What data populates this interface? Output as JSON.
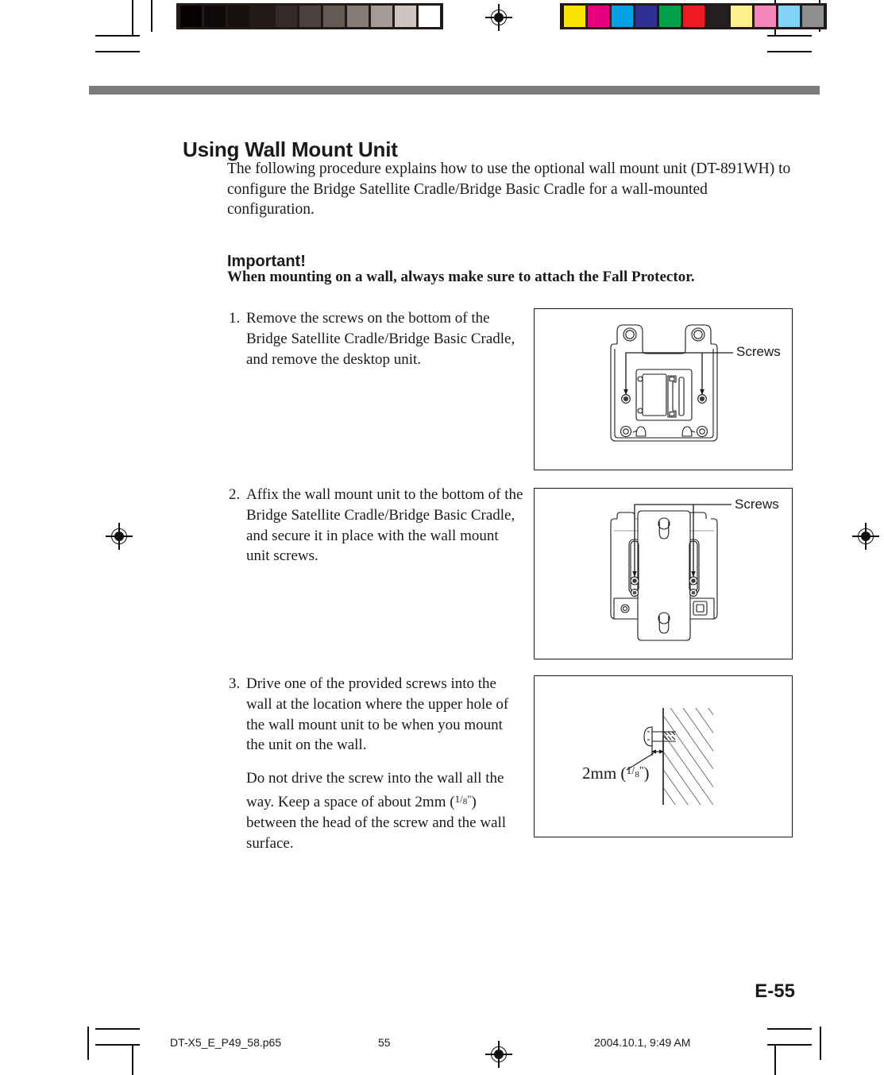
{
  "document": {
    "heading": "Using Wall Mount Unit",
    "intro": "The following procedure explains how to use the optional wall mount unit (DT-891WH) to configure the Bridge Satellite Cradle/Bridge Basic Cradle for a wall-mounted configuration.",
    "important_heading": "Important!",
    "important_text": "When mounting on a wall, always make sure to attach the Fall Protector.",
    "page_number": "E-55"
  },
  "steps": [
    {
      "number": "1.",
      "paragraphs": [
        "Remove the screws on the bottom of the Bridge Satellite Cradle/Bridge Basic Cradle, and remove the desktop unit."
      ]
    },
    {
      "number": "2.",
      "paragraphs": [
        "Affix the wall mount unit to the bottom of the Bridge Satellite Cradle/Bridge Basic Cradle, and secure it in place with the wall mount unit screws."
      ]
    },
    {
      "number": "3.",
      "paragraphs": [
        "Drive one of the provided screws into the wall at the location where the upper hole of the wall mount unit to be when you mount the unit on the wall.",
        "Do not drive the screw into the wall all the way. Keep a space of about 2mm (1/8\") between the head of the screw and the wall surface."
      ]
    }
  ],
  "figures": [
    {
      "id": "cradle-bottom",
      "caption": "Screws",
      "description": "Bottom view of the cradle showing two screws"
    },
    {
      "id": "wall-mount-attached",
      "caption": "Screws",
      "description": "Wall mount plate attached to bottom of cradle, secured with screws"
    },
    {
      "id": "screw-in-wall",
      "caption": "2mm",
      "caption_fraction_num": "1",
      "caption_fraction_den": "8",
      "description": "Screw driven into wall leaving a 2mm gap"
    }
  ],
  "prepress": {
    "grey_wedge": [
      "#050201",
      "#0e0a09",
      "#16100e",
      "#221b19",
      "#352c29",
      "#4b403d",
      "#665a56",
      "#877b77",
      "#a69b97",
      "#cfc4c0",
      "#ffffff"
    ],
    "color_bar": [
      "#fbe500",
      "#e6007e",
      "#00a0e4",
      "#2e3192",
      "#00a14b",
      "#ed1c24",
      "#231f20",
      "#fbf08a",
      "#f385bc",
      "#7fd4f5",
      "#8f8f8f"
    ]
  },
  "footer": {
    "file": "DT-X5_E_P49_58.p65",
    "page": "55",
    "date": "2004.10.1, 9:49 AM"
  }
}
